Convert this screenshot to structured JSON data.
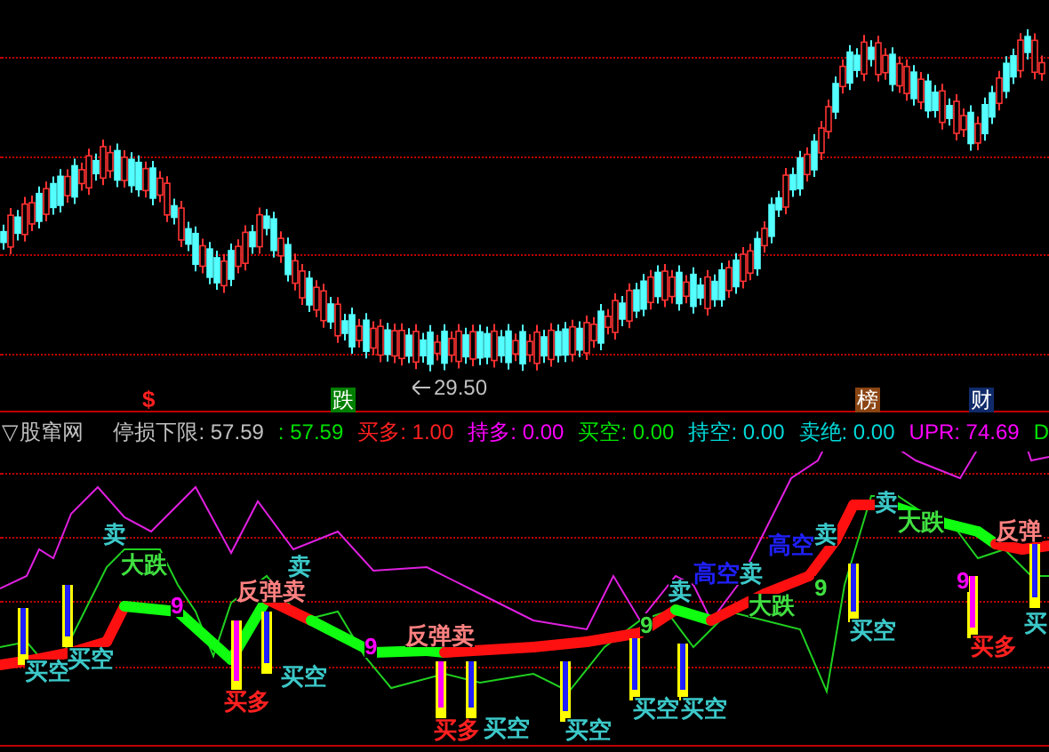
{
  "price_chart": {
    "low_label": "29.50",
    "markers": [
      {
        "text": "$",
        "kind": "plain",
        "color": "#ff2020"
      },
      {
        "text": "跌",
        "kind": "box",
        "color": "#008000"
      },
      {
        "text": "榜",
        "kind": "box",
        "color": "#8b4513"
      },
      {
        "text": "财",
        "kind": "box",
        "color": "#102a6a"
      }
    ]
  },
  "indicator_header": {
    "icon": "▽",
    "title": "股窜网",
    "items": [
      {
        "text": "停损下限: 57.59",
        "color": "#c0c0c0"
      },
      {
        "text": ": 57.59",
        "color": "#00e000"
      },
      {
        "text": "买多: 1.00",
        "color": "#ff2020"
      },
      {
        "text": "持多: 0.00",
        "color": "#ff00ff"
      },
      {
        "text": "买空: 0.00",
        "color": "#00e000"
      },
      {
        "text": "持空: 0.00",
        "color": "#00d8d8"
      },
      {
        "text": "卖绝: 0.00",
        "color": "#00d8d8"
      },
      {
        "text": "UPR: 74.69",
        "color": "#ff00ff"
      },
      {
        "text": "D",
        "color": "#00e000"
      }
    ]
  },
  "signals": [
    {
      "text": "卖",
      "color": "#3cc8c8"
    },
    {
      "text": "大跌",
      "color": "#40e040"
    },
    {
      "text": "9",
      "color": "#ff00ff"
    },
    {
      "text": "买空",
      "color": "#3cc8c8"
    },
    {
      "text": "买空",
      "color": "#3cc8c8"
    },
    {
      "text": "卖",
      "color": "#3cc8c8"
    },
    {
      "text": "反弹卖",
      "color": "#ff8080"
    },
    {
      "text": "买多",
      "color": "#ff2020"
    },
    {
      "text": "买空",
      "color": "#3cc8c8"
    },
    {
      "text": "9",
      "color": "#ff00ff"
    },
    {
      "text": "反弹卖",
      "color": "#ff8080"
    },
    {
      "text": "买多",
      "color": "#ff2020"
    },
    {
      "text": "买空",
      "color": "#3cc8c8"
    },
    {
      "text": "买空",
      "color": "#3cc8c8"
    },
    {
      "text": "9",
      "color": "#40e040"
    },
    {
      "text": "卖",
      "color": "#3cc8c8"
    },
    {
      "text": "高空",
      "color": "#2020ff"
    },
    {
      "text": "卖",
      "color": "#3cc8c8"
    },
    {
      "text": "高空",
      "color": "#2020ff"
    },
    {
      "text": "卖",
      "color": "#3cc8c8"
    },
    {
      "text": "大跌",
      "color": "#40e040"
    },
    {
      "text": "买空",
      "color": "#3cc8c8"
    },
    {
      "text": "买空",
      "color": "#3cc8c8"
    },
    {
      "text": "9",
      "color": "#40e040"
    },
    {
      "text": "卖",
      "color": "#3cc8c8"
    },
    {
      "text": "大跌",
      "color": "#40e040"
    },
    {
      "text": "9",
      "color": "#ff00ff"
    },
    {
      "text": "买空",
      "color": "#3cc8c8"
    },
    {
      "text": "买多",
      "color": "#ff2020"
    },
    {
      "text": "反弹",
      "color": "#ff8080"
    },
    {
      "text": "买",
      "color": "#3cc8c8"
    }
  ]
}
